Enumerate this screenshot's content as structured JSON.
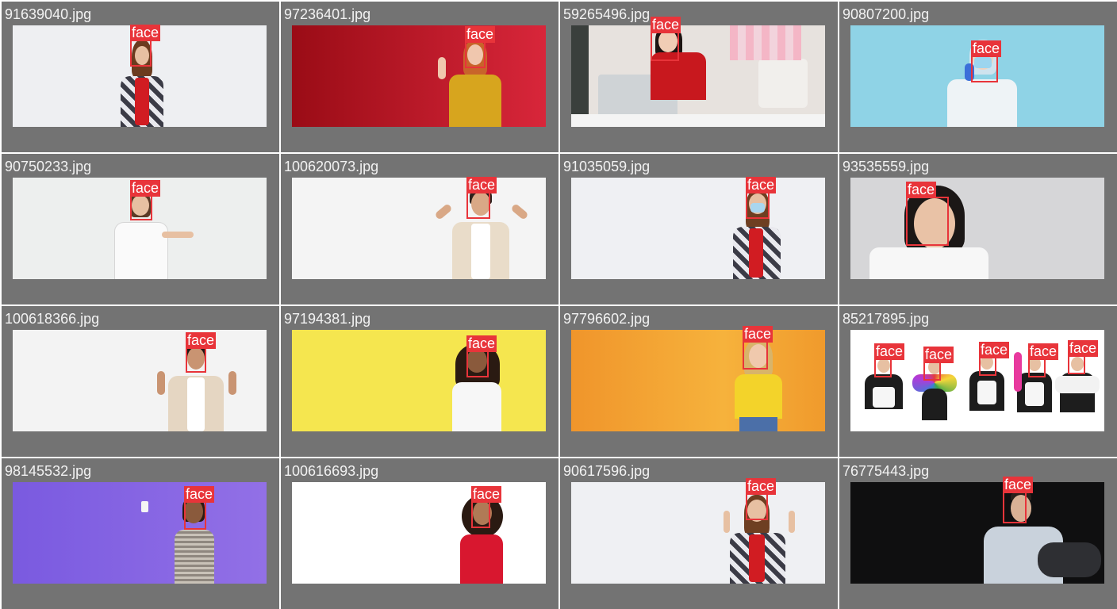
{
  "detector": {
    "class_label": "face",
    "box_color": "#e8343a"
  },
  "tiles": [
    {
      "filename": "91639040.jpg",
      "bg": "#eeeff2",
      "faces": 1
    },
    {
      "filename": "97236401.jpg",
      "bg": "#b0121c",
      "faces": 1
    },
    {
      "filename": "59265496.jpg",
      "bg": "#e9e4e2",
      "faces": 1
    },
    {
      "filename": "90807200.jpg",
      "bg": "#8fd3e6",
      "faces": 1
    },
    {
      "filename": "90750233.jpg",
      "bg": "#edefee",
      "faces": 1
    },
    {
      "filename": "100620073.jpg",
      "bg": "#f4f4f4",
      "faces": 1
    },
    {
      "filename": "91035059.jpg",
      "bg": "#eff0f3",
      "faces": 1
    },
    {
      "filename": "93535559.jpg",
      "bg": "#d6d6d8",
      "faces": 1
    },
    {
      "filename": "100618366.jpg",
      "bg": "#f3f3f3",
      "faces": 1
    },
    {
      "filename": "97194381.jpg",
      "bg": "#f5e64f",
      "faces": 1
    },
    {
      "filename": "97796602.jpg",
      "bg": "#f3a430",
      "faces": 1
    },
    {
      "filename": "85217895.jpg",
      "bg": "#ffffff",
      "faces": 5
    },
    {
      "filename": "98145532.jpg",
      "bg": "#8462df",
      "faces": 1
    },
    {
      "filename": "100616693.jpg",
      "bg": "#ffffff",
      "faces": 1
    },
    {
      "filename": "90617596.jpg",
      "bg": "#eff0f3",
      "faces": 1
    },
    {
      "filename": "76775443.jpg",
      "bg": "#0f0f10",
      "faces": 1
    }
  ]
}
